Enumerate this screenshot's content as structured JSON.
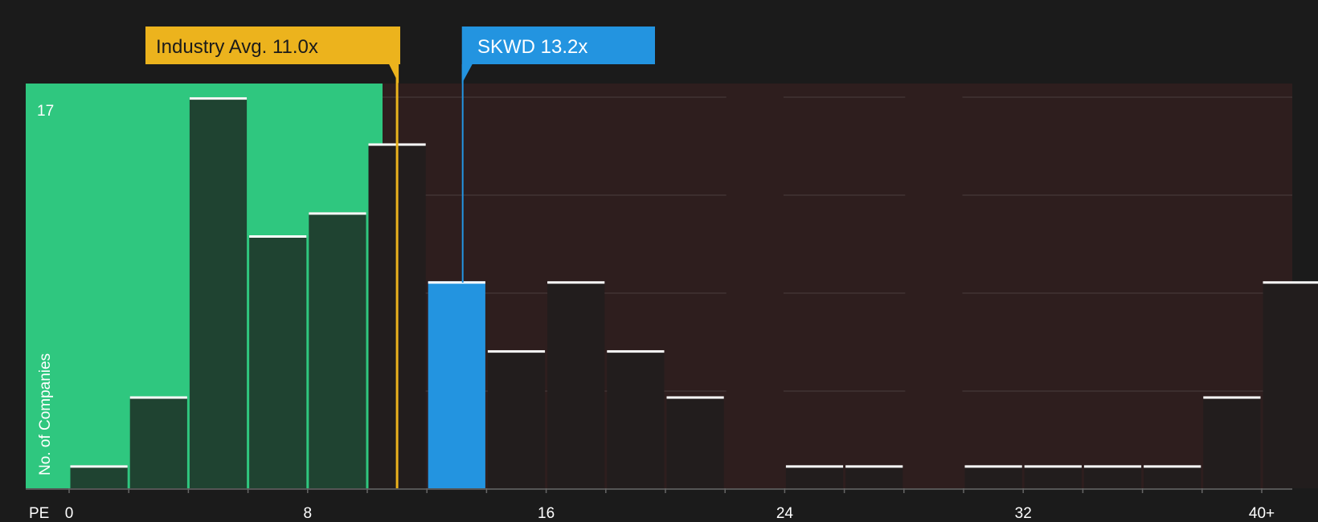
{
  "chart_data": {
    "type": "bar",
    "xlabel": "PE",
    "ylabel": "No. of Companies",
    "ymax_label": "17",
    "ylim": [
      0,
      17.6
    ],
    "xlim": [
      0,
      40
    ],
    "x_ticks": [
      {
        "value": 0,
        "label": "0"
      },
      {
        "value": 8,
        "label": "8"
      },
      {
        "value": 16,
        "label": "16"
      },
      {
        "value": 24,
        "label": "24"
      },
      {
        "value": 32,
        "label": "32"
      },
      {
        "value": 40,
        "label": "40+"
      }
    ],
    "bin_width": 2,
    "bins": [
      {
        "x0": 0,
        "count": 1
      },
      {
        "x0": 2,
        "count": 4
      },
      {
        "x0": 4,
        "count": 17
      },
      {
        "x0": 6,
        "count": 11
      },
      {
        "x0": 8,
        "count": 12
      },
      {
        "x0": 10,
        "count": 15
      },
      {
        "x0": 12,
        "count": 9
      },
      {
        "x0": 14,
        "count": 6
      },
      {
        "x0": 16,
        "count": 9
      },
      {
        "x0": 18,
        "count": 6
      },
      {
        "x0": 20,
        "count": 4
      },
      {
        "x0": 22,
        "count": 0
      },
      {
        "x0": 24,
        "count": 1
      },
      {
        "x0": 26,
        "count": 1
      },
      {
        "x0": 28,
        "count": 0
      },
      {
        "x0": 30,
        "count": 1
      },
      {
        "x0": 32,
        "count": 1
      },
      {
        "x0": 34,
        "count": 1
      },
      {
        "x0": 36,
        "count": 1
      },
      {
        "x0": 38,
        "count": 4
      },
      {
        "x0": 40,
        "count": 9
      }
    ],
    "industry_avg": {
      "value": 11.0,
      "label": "Industry Avg. 11.0x"
    },
    "company": {
      "ticker": "SKWD",
      "value": 13.2,
      "label": "SKWD 13.2x"
    },
    "colors": {
      "background": "#1b1b1b",
      "below_zone": "#2fc77f",
      "above_zone": "#2e1e1e",
      "bar_in_green": "#1f4331",
      "bar_in_red": "#221d1d",
      "company_bar": "#2394e0",
      "industry": "#ecb31d",
      "bar_cap": "#ffffff",
      "grid": "#4a3e3e"
    }
  }
}
